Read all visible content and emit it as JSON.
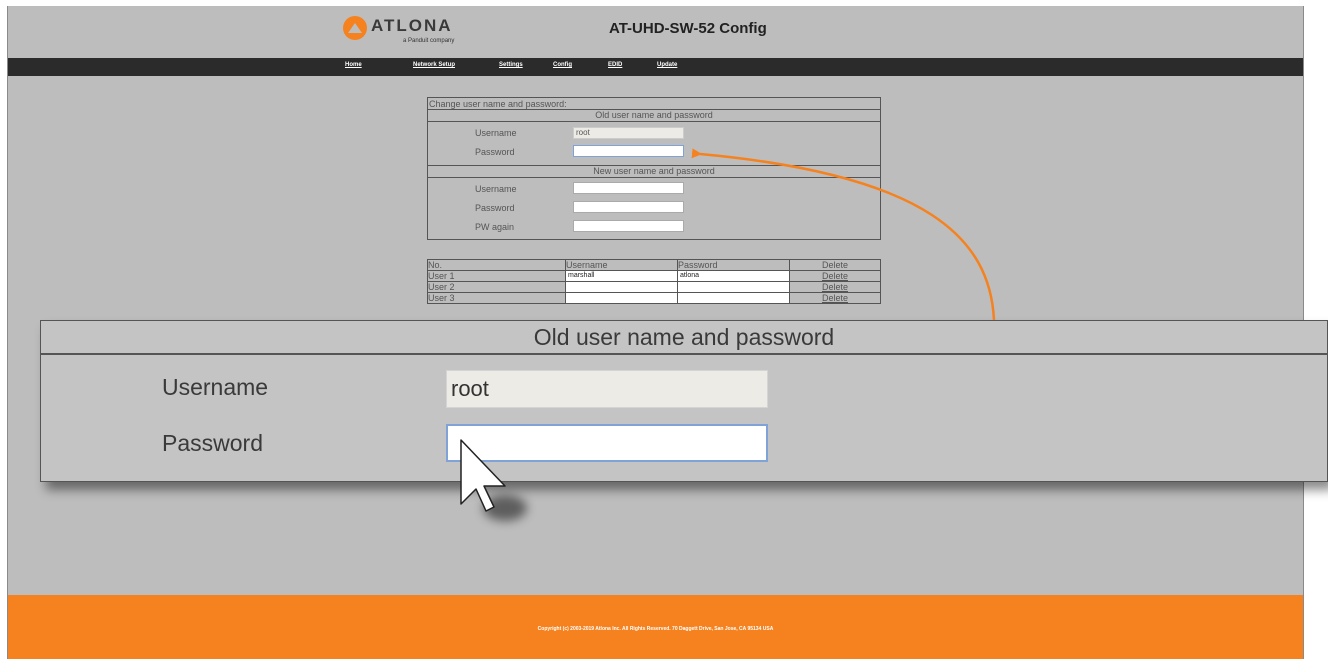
{
  "header": {
    "logo_word": "ATLONA",
    "logo_sub": "a Panduit company",
    "title": "AT-UHD-SW-52 Config"
  },
  "nav": {
    "home": "Home",
    "network_setup": "Network Setup",
    "settings": "Settings",
    "config": "Config",
    "edid": "EDID",
    "update": "Update"
  },
  "credentials": {
    "caption": "Change user name and password:",
    "old_section": "Old user name and password",
    "new_section": "New user name and password",
    "username_label": "Username",
    "password_label": "Password",
    "pw_again_label": "PW again",
    "old_username_value": "root",
    "old_password_value": "",
    "new_username_value": "",
    "new_password_value": "",
    "pw_again_value": ""
  },
  "users_table": {
    "headers": [
      "No.",
      "Username",
      "Password",
      "Delete"
    ],
    "rows": [
      {
        "no": "User 1",
        "username": "marshall",
        "password": "atlona",
        "delete": "Delete"
      },
      {
        "no": "User 2",
        "username": "",
        "password": "",
        "delete": "Delete"
      },
      {
        "no": "User 3",
        "username": "",
        "password": "",
        "delete": "Delete"
      }
    ]
  },
  "zoom": {
    "heading": "Old user name and password",
    "username_label": "Username",
    "password_label": "Password",
    "username_value": "root",
    "password_value": ""
  },
  "footer": {
    "copyright": "Copyright (c) 2003-2019 Atlona Inc. All Rights Reserved. 70 Daggett Drive, San Jose, CA 95134 USA"
  },
  "colors": {
    "accent": "#f5821f",
    "nav_bg": "#2b2b2b",
    "page_bg": "#bdbdbd",
    "focus_border": "#7fa3d6",
    "readonly_bg": "#ecebe6"
  },
  "icons": [
    "atlona-logo-icon",
    "arrow-pointer-icon",
    "mouse-cursor-icon"
  ]
}
